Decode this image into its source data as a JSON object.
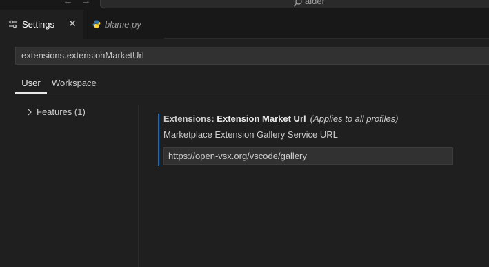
{
  "titlebar": {
    "search_text": "alder",
    "icons": {
      "back": "arrow-left-icon",
      "forward": "arrow-right-icon",
      "search": "search-icon"
    }
  },
  "tabs": [
    {
      "label": "Settings",
      "icon": "settings-icon",
      "active": true,
      "close_icon": "close-icon"
    },
    {
      "label": "blame.py",
      "icon": "python-icon",
      "active": false
    }
  ],
  "search": {
    "value": "extensions.extensionMarketUrl"
  },
  "scope_tabs": [
    {
      "label": "User",
      "active": true
    },
    {
      "label": "Workspace",
      "active": false
    }
  ],
  "toc": [
    {
      "label": "Features (1)",
      "icon": "chevron-right-icon"
    }
  ],
  "setting": {
    "category": "Extensions: ",
    "name": "Extension Market Url",
    "applies": "(Applies to all profiles)",
    "description": "Marketplace Extension Gallery Service URL",
    "value": "https://open-vsx.org/vscode/gallery"
  },
  "colors": {
    "background": "#1f1f1f",
    "accent": "#0078d4",
    "python_blue": "#3776ab",
    "python_yellow": "#ffd43b"
  }
}
